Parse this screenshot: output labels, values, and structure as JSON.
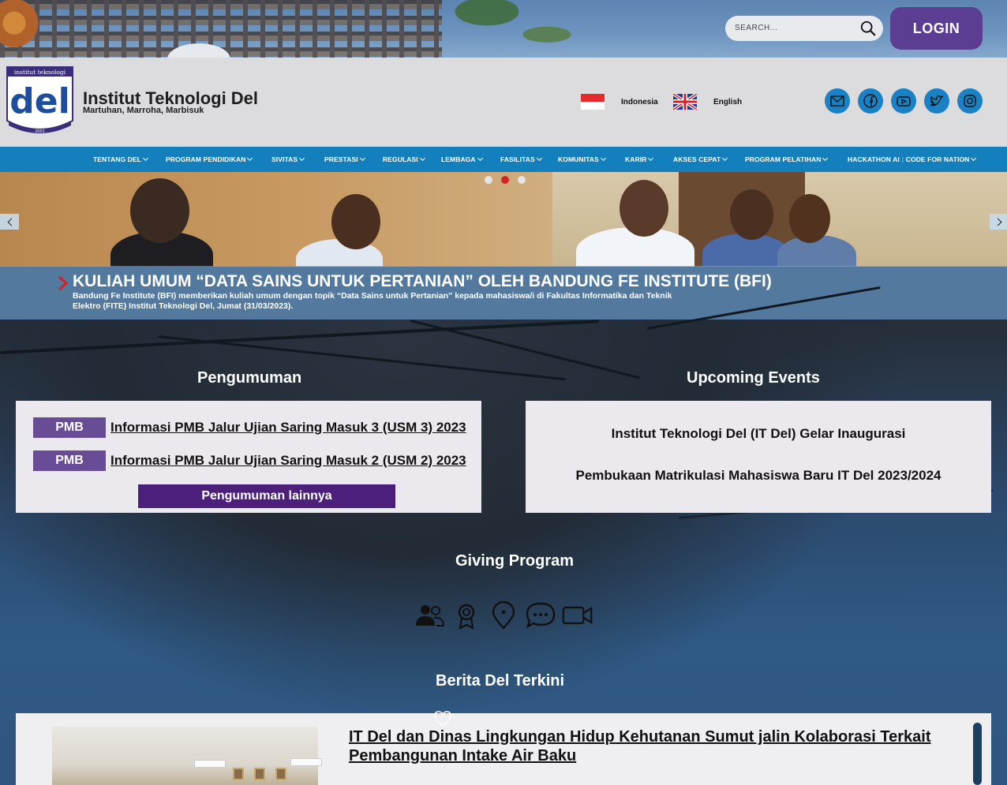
{
  "top": {
    "search_placeholder": "SEARCH...",
    "login_label": "LOGIN"
  },
  "header": {
    "logo_text_top": "institut teknologi",
    "logo_text_main": "del",
    "logo_year": "2001",
    "title": "Institut Teknologi Del",
    "subtitle": "Martuhan, Marroha, Marbisuk",
    "languages": [
      "Indonesia",
      "English"
    ],
    "social_icons": [
      "mail-icon",
      "facebook-icon",
      "youtube-icon",
      "twitter-icon",
      "instagram-icon"
    ]
  },
  "nav": {
    "items": [
      "TENTANG DEL",
      "PROGRAM PENDIDIKAN",
      "SIVITAS",
      "PRESTASI",
      "REGULASI",
      "LEMBAGA",
      "FASILITAS",
      "KOMUNITAS",
      "KARIR",
      "AKSES CEPAT",
      "PROGRAM PELATIHAN",
      "HACKATHON AI : CODE FOR NATION"
    ]
  },
  "hero": {
    "title": "KULIAH UMUM “DATA SAINS UNTUK PERTANIAN” OLEH BANDUNG FE INSTITUTE (BFI)",
    "text": "Bandung Fe Institute (BFI) memberikan kuliah umum dengan topik “Data Sains untuk Pertanian” kepada mahasiswa/i di Fakultas Informatika dan Teknik Elektro (FITE) Institut Teknologi Del, Jumat (31/03/2023).",
    "slides_total": 3,
    "active_slide": 2
  },
  "announcements": {
    "heading": "Pengumuman",
    "items": [
      {
        "tag": "PMB",
        "title": "Informasi PMB Jalur Ujian Saring Masuk 3 (USM 3) 2023"
      },
      {
        "tag": "PMB",
        "title": "Informasi PMB Jalur Ujian Saring Masuk 2 (USM 2) 2023"
      }
    ],
    "more_label": "Pengumuman lainnya"
  },
  "events": {
    "heading": "Upcoming Events",
    "items": [
      "Institut Teknologi Del (IT Del) Gelar Inaugurasi",
      "Pembukaan Matrikulasi Mahasiswa Baru IT Del 2023/2024"
    ]
  },
  "giving": {
    "heading": "Giving Program",
    "icons": [
      "users-icon",
      "award-icon",
      "location-pin-icon",
      "chat-bubble-icon",
      "video-camera-icon"
    ]
  },
  "news": {
    "heading": "Berita Del Terkini",
    "items": [
      {
        "title": "IT Del dan Dinas Lingkungan Hidup Kehutanan Sumut jalin Kolaborasi Terkait Pembangunan Intake Air Baku"
      }
    ]
  },
  "colors": {
    "login_bg": "#5b3d92",
    "nav_bg": "#147fbd",
    "tag_bg": "#684d96",
    "more_btn_bg": "#4c1f7a",
    "social_bg": "#1a82c4"
  }
}
